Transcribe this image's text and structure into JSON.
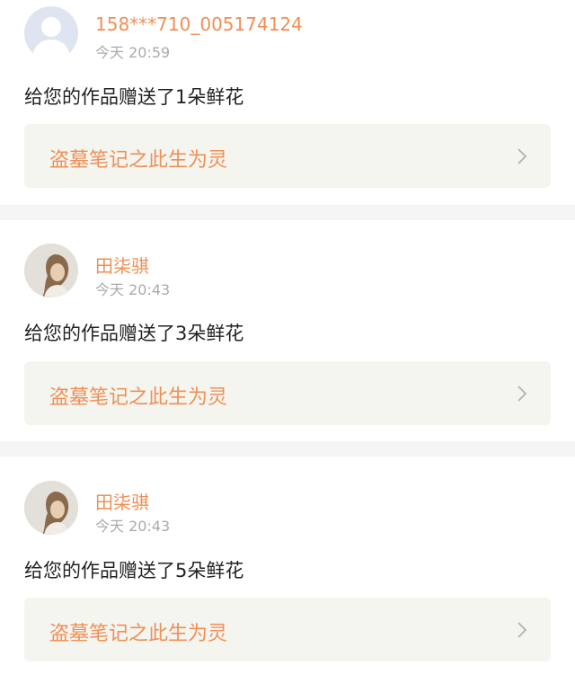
{
  "notifications": [
    {
      "username": "158***710_005174124",
      "time": "今天 20:59",
      "message": "给您的作品赠送了1朵鲜花",
      "work_title": "盗墓笔记之此生为灵",
      "avatar_icon": "default-user-avatar"
    },
    {
      "username": "田柒骐",
      "time": "今天 20:43",
      "message": "给您的作品赠送了3朵鲜花",
      "work_title": "盗墓笔记之此生为灵",
      "avatar_icon": "user-photo-avatar"
    },
    {
      "username": "田柒骐",
      "time": "今天 20:43",
      "message": "给您的作品赠送了5朵鲜花",
      "work_title": "盗墓笔记之此生为灵",
      "avatar_icon": "user-photo-avatar"
    }
  ],
  "colors": {
    "accent": "#ef8f55",
    "card_link_bg": "#f5f5f0",
    "divider": "#f5f5f5",
    "time": "#aaaaaa",
    "text": "#222222"
  }
}
